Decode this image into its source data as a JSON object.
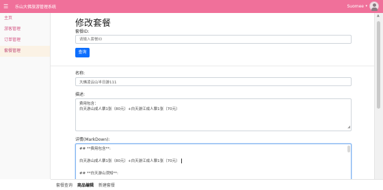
{
  "header": {
    "app_title": "乐山大佛旅游管理系统",
    "user_name": "Suomee",
    "hamburger": "☰",
    "caret": "▾"
  },
  "sidebar": {
    "items": [
      {
        "label": "主页",
        "active": false
      },
      {
        "label": "游客管理",
        "active": false
      },
      {
        "label": "订单管理",
        "active": false
      },
      {
        "label": "套餐管理",
        "active": true
      }
    ]
  },
  "main": {
    "title": "修改套餐",
    "id_label": "套餐ID:",
    "id_placeholder": "请输入套餐ID",
    "query_button": "查询",
    "name_label": "名称:",
    "name_value": "大佛凌云山半日游111",
    "desc_label": "描述:",
    "desc_lines": [
      "费用包含：",
      "白天游山成人票1张（80元）+白天游江成人票1张（70元）"
    ],
    "details_label": "详情(MarkDown):",
    "details_lines": [
      "## **费用包含**:",
      "",
      "白天游山成人票1张（80元）+白天游江成人票1张（70元）",
      "",
      "## **白天游山须知**:"
    ]
  },
  "bottom_tabs": [
    {
      "label": "套餐查询",
      "active": false
    },
    {
      "label": "商品编辑",
      "active": true
    },
    {
      "label": "新建套餐",
      "active": false
    }
  ],
  "colors": {
    "topbar": "#f0709a",
    "accent": "#d35683",
    "primary_button": "#0d6efd"
  }
}
